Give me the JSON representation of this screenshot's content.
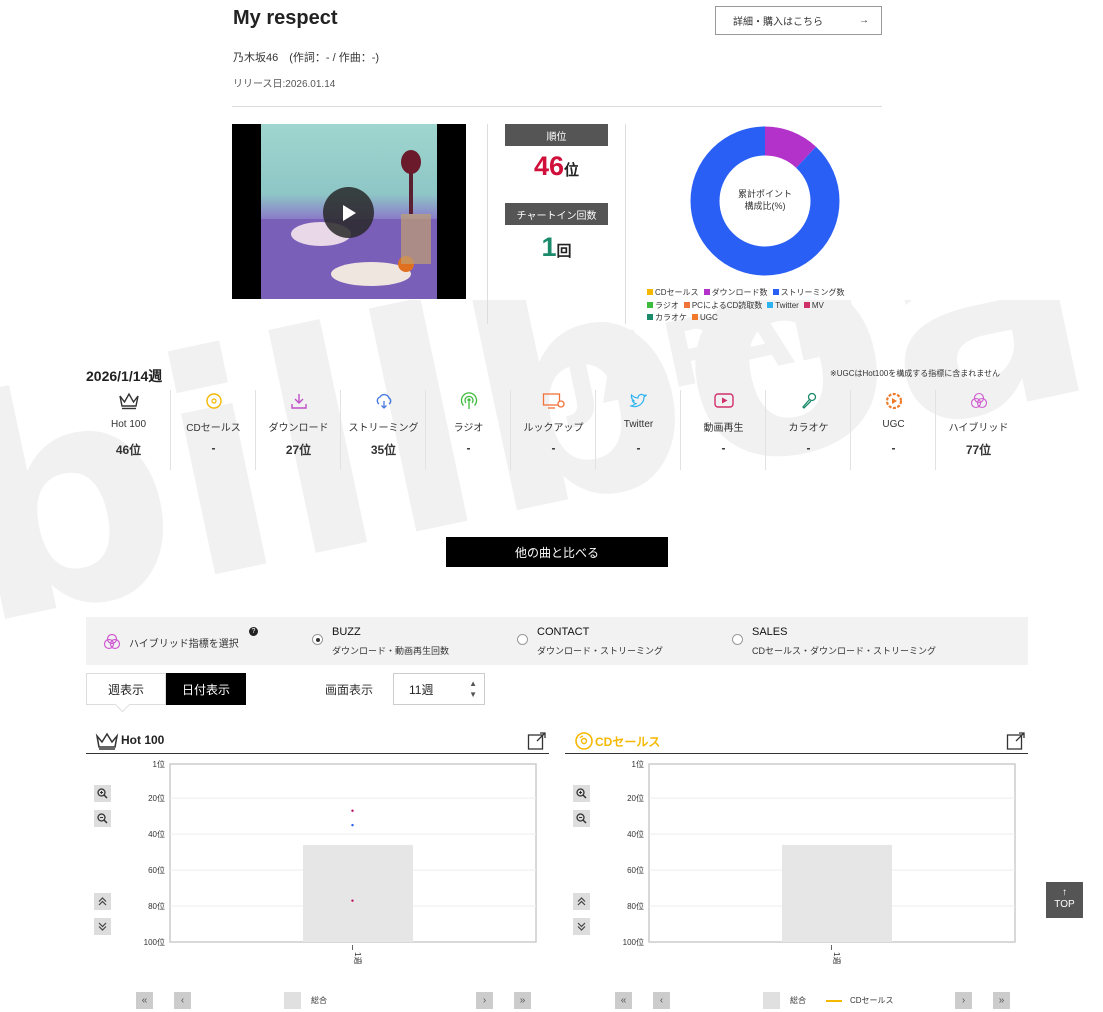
{
  "song": {
    "title": "My respect",
    "buy_label": "詳細・購入はこちら",
    "artist_line": "乃木坂46　(作詞：- / 作曲：-)",
    "release_date": "リリース日:2026.01.14"
  },
  "ranking": {
    "rank_label": "順位",
    "rank_value": "46",
    "rank_unit": "位",
    "chartin_label": "チャートイン回数",
    "chartin_value": "1",
    "chartin_unit": "回"
  },
  "composition": {
    "center_label_1": "累計ポイント",
    "center_label_2": "構成比(%)",
    "slices": [
      {
        "name": "ダウンロード数",
        "percent": 12,
        "color": "#b332c9"
      },
      {
        "name": "ストリーミング数",
        "percent": 88,
        "color": "#2a5ff5"
      }
    ],
    "legend": [
      {
        "label": "CDセールス",
        "color": "#f5b800"
      },
      {
        "label": "ダウンロード数",
        "color": "#b332c9"
      },
      {
        "label": "ストリーミング数",
        "color": "#2a5ff5"
      },
      {
        "label": "ラジオ",
        "color": "#3dbb3d"
      },
      {
        "label": "PCによるCD読取数",
        "color": "#f0733a"
      },
      {
        "label": "Twitter",
        "color": "#2db4f0"
      },
      {
        "label": "MV",
        "color": "#d0306a"
      },
      {
        "label": "カラオケ",
        "color": "#1a8a6a"
      },
      {
        "label": "UGC",
        "color": "#f07a2a"
      }
    ]
  },
  "week": {
    "label": "2026/1/14週",
    "ugc_note": "※UGCはHot100を構成する指標に含まれません",
    "metrics": [
      {
        "icon": "crown-icon",
        "label": "Hot 100",
        "value": "46位"
      },
      {
        "icon": "cd-icon",
        "label": "CDセールス",
        "value": "-"
      },
      {
        "icon": "download-icon",
        "label": "ダウンロード",
        "value": "27位"
      },
      {
        "icon": "streaming-icon",
        "label": "ストリーミング",
        "value": "35位"
      },
      {
        "icon": "radio-icon",
        "label": "ラジオ",
        "value": "-"
      },
      {
        "icon": "lookup-icon",
        "label": "ルックアップ",
        "value": "-"
      },
      {
        "icon": "twitter-icon",
        "label": "Twitter",
        "value": "-"
      },
      {
        "icon": "video-icon",
        "label": "動画再生",
        "value": "-"
      },
      {
        "icon": "mic-icon",
        "label": "カラオケ",
        "value": "-"
      },
      {
        "icon": "ugc-icon",
        "label": "UGC",
        "value": "-"
      },
      {
        "icon": "hybrid-icon",
        "label": "ハイブリッド",
        "value": "77位"
      }
    ]
  },
  "compare_label": "他の曲と比べる",
  "hybrid": {
    "title": "ハイブリッド指標を選択",
    "help": "?",
    "options": [
      {
        "title": "BUZZ",
        "sub": "ダウンロード・動画再生回数",
        "selected": true
      },
      {
        "title": "CONTACT",
        "sub": "ダウンロード・ストリーミング",
        "selected": false
      },
      {
        "title": "SALES",
        "sub": "CDセールス・ダウンロード・ストリーミング",
        "selected": false
      }
    ]
  },
  "view": {
    "weekly": "週表示",
    "daily": "日付表示",
    "display_label": "画面表示",
    "display_value": "11週"
  },
  "charts": [
    {
      "title": "Hot 100",
      "legend_total": "総合",
      "legend_series": "",
      "chart_data": {
        "type": "bar",
        "categories": [
          "1週"
        ],
        "ylim": [
          1,
          100
        ],
        "y_reversed": true,
        "yticks": [
          "1位",
          "20位",
          "40位",
          "60位",
          "80位",
          "100位"
        ],
        "series": [
          {
            "name": "総合",
            "values": [
              46
            ]
          }
        ],
        "markers": [
          {
            "value": 27,
            "color": "#c0106a"
          },
          {
            "value": 35,
            "color": "#2a5ff5"
          },
          {
            "value": 77,
            "color": "#c0106a"
          }
        ]
      }
    },
    {
      "title": "CDセールス",
      "legend_total": "総合",
      "legend_series": "CDセールス",
      "chart_data": {
        "type": "bar",
        "categories": [
          "1週"
        ],
        "ylim": [
          1,
          100
        ],
        "y_reversed": true,
        "yticks": [
          "1位",
          "20位",
          "40位",
          "60位",
          "80位",
          "100位"
        ],
        "series": [
          {
            "name": "総合",
            "values": [
              46
            ]
          }
        ],
        "markers": []
      }
    }
  ],
  "top_label": "TOP"
}
